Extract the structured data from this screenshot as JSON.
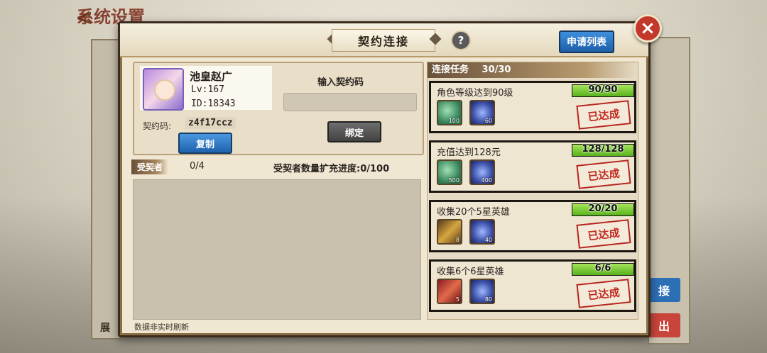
{
  "background": {
    "back_arrow": "<",
    "title": "系统设置",
    "left_label": "展",
    "right_button_1": "接",
    "right_button_2": "出"
  },
  "dialog": {
    "title": "契约连接",
    "help": "?",
    "apply_button": "申请列表",
    "close": "×"
  },
  "profile": {
    "name": "池皇赵广",
    "level": "Lv:167",
    "id": "ID:18343",
    "code_label": "契约码:",
    "code_value": "z4f17ccz",
    "copy_button": "复制"
  },
  "bind": {
    "input_label": "输入契约码",
    "input_value": "",
    "bind_button": "绑定"
  },
  "contracted": {
    "label": "受契者",
    "count": "0/4",
    "expand_progress": "受契者数量扩充进度:0/100",
    "footnote": "数据非实时刷新"
  },
  "tasks": {
    "header": "连接任务",
    "header_count": "30/30",
    "stamp_text": "已达成",
    "items": [
      {
        "name": "角色等级达到90级",
        "progress": "90/90",
        "fraction": 1.0,
        "rewards": [
          {
            "icon": "jade-icon",
            "count": "100"
          },
          {
            "icon": "coin-icon",
            "count": "60"
          }
        ]
      },
      {
        "name": "充值达到128元",
        "progress": "128/128",
        "fraction": 1.0,
        "rewards": [
          {
            "icon": "jade-icon",
            "count": "500"
          },
          {
            "icon": "coin-icon",
            "count": "400"
          }
        ]
      },
      {
        "name": "收集20个5星英雄",
        "progress": "20/20",
        "fraction": 1.0,
        "rewards": [
          {
            "icon": "staff-icon",
            "count": "8"
          },
          {
            "icon": "coin-icon",
            "count": "40"
          }
        ]
      },
      {
        "name": "收集6个6星英雄",
        "progress": "6/6",
        "fraction": 1.0,
        "rewards": [
          {
            "icon": "hammer-icon",
            "count": "5"
          },
          {
            "icon": "coin-icon",
            "count": "80"
          }
        ]
      }
    ]
  }
}
